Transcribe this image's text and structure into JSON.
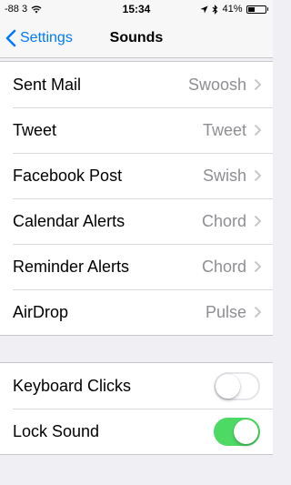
{
  "status_bar": {
    "signal": "-88 3",
    "time": "15:34",
    "battery_percent": "41%",
    "battery_level": 0.41,
    "icons": [
      "wifi-icon",
      "location-arrow-icon",
      "bluetooth-icon",
      "battery-icon"
    ]
  },
  "nav": {
    "back_label": "Settings",
    "title": "Sounds"
  },
  "sounds": [
    {
      "label": "Sent Mail",
      "value": "Swoosh"
    },
    {
      "label": "Tweet",
      "value": "Tweet"
    },
    {
      "label": "Facebook Post",
      "value": "Swish"
    },
    {
      "label": "Calendar Alerts",
      "value": "Chord"
    },
    {
      "label": "Reminder Alerts",
      "value": "Chord"
    },
    {
      "label": "AirDrop",
      "value": "Pulse"
    }
  ],
  "toggles": [
    {
      "label": "Keyboard Clicks",
      "on": false
    },
    {
      "label": "Lock Sound",
      "on": true
    }
  ],
  "colors": {
    "accent": "#007aff",
    "toggle_on": "#4cd964",
    "secondary_text": "#8e8e93",
    "background": "#efeff4"
  }
}
